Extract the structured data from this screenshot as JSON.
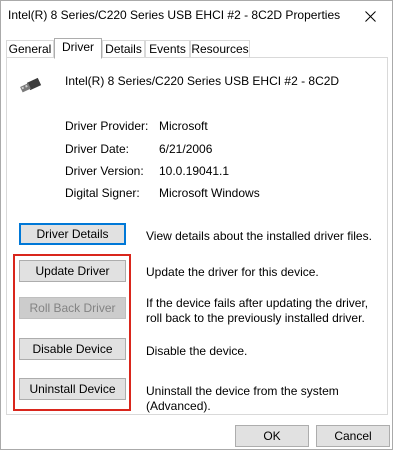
{
  "window": {
    "title": "Intel(R) 8 Series/C220 Series USB EHCI #2 - 8C2D Properties",
    "close_icon": "close-icon"
  },
  "tabs": [
    {
      "label": "General",
      "active": false
    },
    {
      "label": "Driver",
      "active": true
    },
    {
      "label": "Details",
      "active": false
    },
    {
      "label": "Events",
      "active": false
    },
    {
      "label": "Resources",
      "active": false
    }
  ],
  "device": {
    "icon": "usb-connector-icon",
    "name": "Intel(R) 8 Series/C220 Series USB EHCI #2 - 8C2D"
  },
  "properties": [
    {
      "label": "Driver Provider:",
      "value": "Microsoft"
    },
    {
      "label": "Driver Date:",
      "value": "6/21/2006"
    },
    {
      "label": "Driver Version:",
      "value": "10.0.19041.1"
    },
    {
      "label": "Digital Signer:",
      "value": "Microsoft Windows"
    }
  ],
  "actions": [
    {
      "label": "Driver Details",
      "description": "View details about the installed driver files.",
      "state": "focused"
    },
    {
      "label": "Update Driver",
      "description": "Update the driver for this device.",
      "state": "normal"
    },
    {
      "label": "Roll Back Driver",
      "description": "If the device fails after updating the driver, roll back to the previously installed driver.",
      "state": "disabled"
    },
    {
      "label": "Disable Device",
      "description": "Disable the device.",
      "state": "normal"
    },
    {
      "label": "Uninstall Device",
      "description": "Uninstall the device from the system (Advanced).",
      "state": "normal"
    }
  ],
  "footer": {
    "ok_label": "OK",
    "cancel_label": "Cancel"
  },
  "colors": {
    "accent": "#0078d7",
    "highlight": "#d9261c",
    "button_face": "#e1e1e1"
  }
}
